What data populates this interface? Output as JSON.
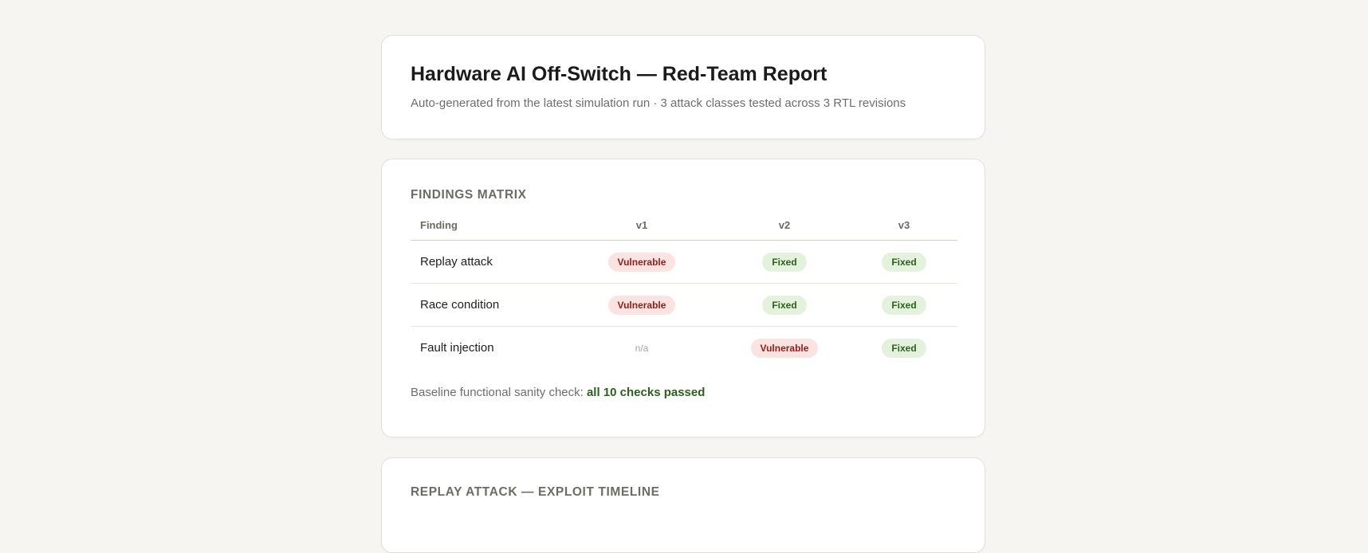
{
  "header": {
    "title": "Hardware AI Off-Switch — Red-Team Report",
    "subtitle": "Auto-generated from the latest simulation run · 3 attack classes tested across 3 RTL revisions"
  },
  "matrix": {
    "section_title": "FINDINGS MATRIX",
    "columns": [
      "Finding",
      "v1",
      "v2",
      "v3"
    ],
    "rows": [
      {
        "finding": "Replay attack",
        "cells": [
          "Vulnerable",
          "Fixed",
          "Fixed"
        ]
      },
      {
        "finding": "Race condition",
        "cells": [
          "Vulnerable",
          "Fixed",
          "Fixed"
        ]
      },
      {
        "finding": "Fault injection",
        "cells": [
          "n/a",
          "Vulnerable",
          "Fixed"
        ]
      }
    ],
    "sanity_label": "Baseline functional sanity check:",
    "sanity_result": "all 10 checks passed"
  },
  "timeline": {
    "section_title": "REPLAY ATTACK — EXPLOIT TIMELINE"
  },
  "colors": {
    "page_background": "#f6f5f1",
    "vulnerable_bg": "#fbe3e1",
    "vulnerable_text": "#8f1d1b",
    "fixed_bg": "#e3f1dd",
    "fixed_text": "#2c5e1d"
  }
}
